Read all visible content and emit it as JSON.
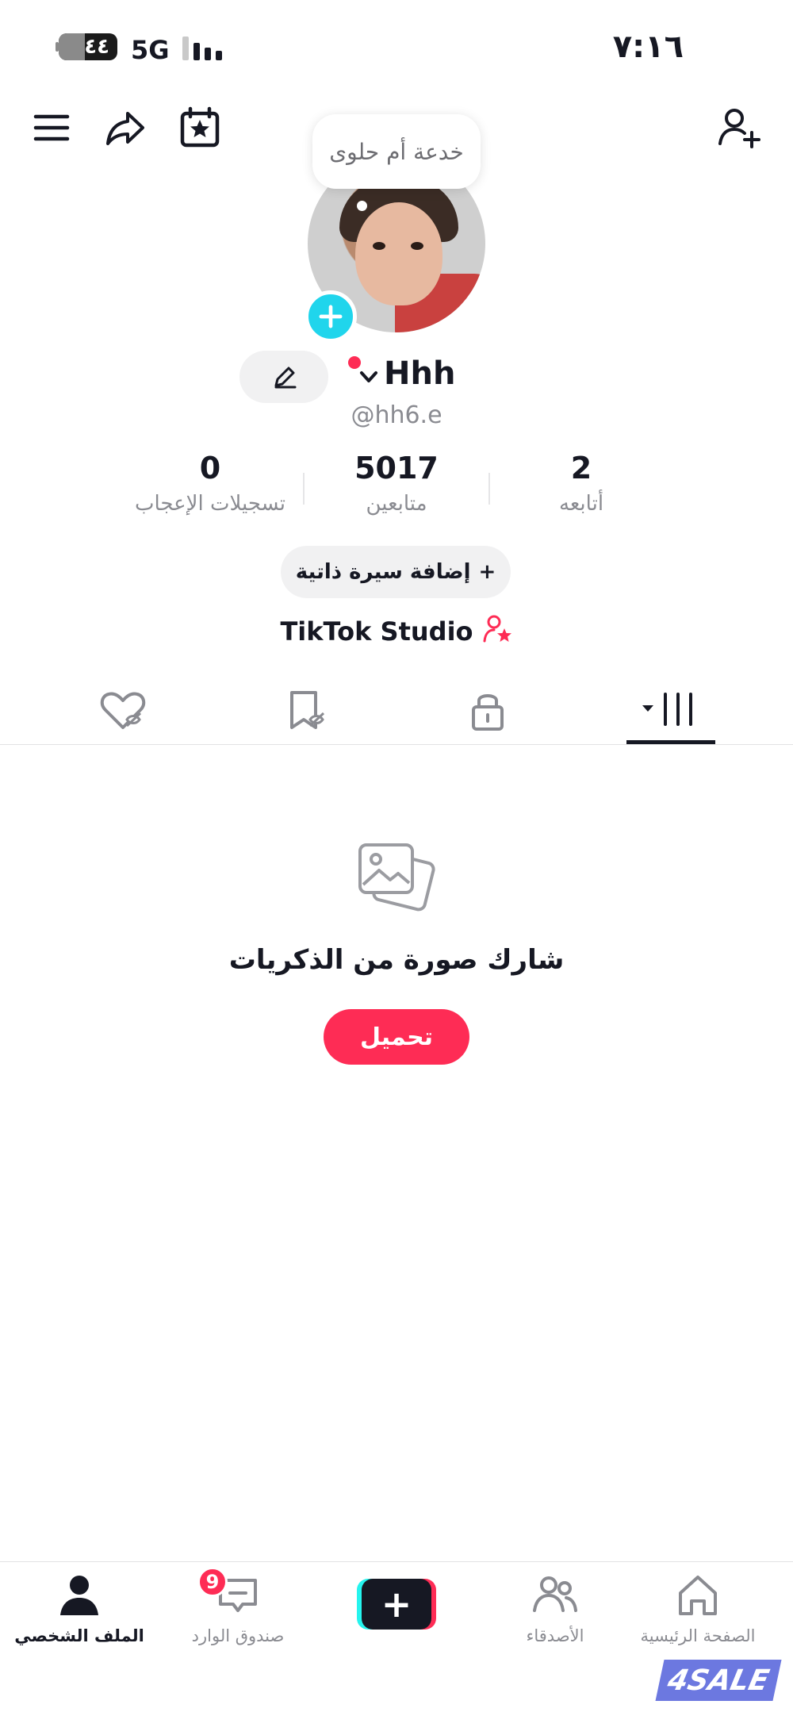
{
  "status_bar": {
    "time": "٧:١٦",
    "battery": "٤٤",
    "battery_level_percent": 44,
    "network": "5G"
  },
  "profile": {
    "note_bubble": "خدعة أم حلوى",
    "display_name": "Hhh",
    "username": "@hh6.e",
    "stats": [
      {
        "value": "2",
        "label": "أتابعه"
      },
      {
        "value": "5017",
        "label": "متابعين"
      },
      {
        "value": "0",
        "label": "تسجيلات الإعجاب"
      }
    ],
    "add_bio_label": "إضافة سيرة ذاتية",
    "studio_label": "TikTok Studio"
  },
  "empty_state": {
    "title": "شارك صورة من الذكريات",
    "button_label": "تحميل"
  },
  "bottom_nav": {
    "home": "الصفحة الرئيسية",
    "friends": "الأصدقاء",
    "inbox": "صندوق الوارد",
    "inbox_badge": "9",
    "profile": "الملف الشخصي"
  },
  "watermark": "4SALE",
  "colors": {
    "accent": "#fe2c55",
    "cyan": "#20d5ec",
    "text": "#161823",
    "muted": "#8a8b91"
  }
}
